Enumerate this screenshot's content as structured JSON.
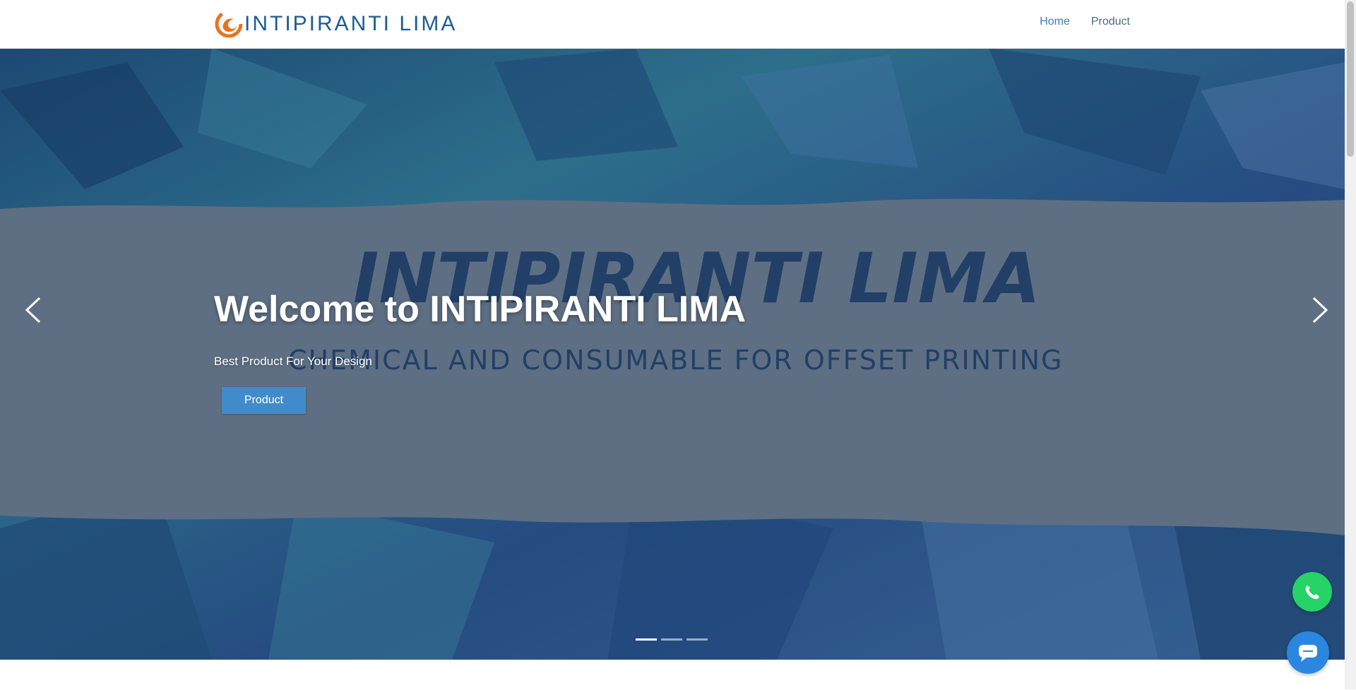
{
  "brand": {
    "name": "INTIPIRANTI LIMA",
    "logo_icon": "spiral-sun-logo-icon",
    "logo_color": "#e8731f",
    "name_color": "#1d5c93"
  },
  "nav": {
    "items": [
      {
        "label": "Home"
      },
      {
        "label": "Product"
      }
    ]
  },
  "hero": {
    "art_title": "INTIPIRANTI LIMA",
    "art_subtitle": "CHEMICAL AND CONSUMABLE FOR OFFSET PRINTING",
    "title": "Welcome to INTIPIRANTI LIMA",
    "subtitle": "Best Product For Your Design",
    "button_label": "Product",
    "button_color": "#428bca",
    "prev_icon": "chevron-left-icon",
    "next_icon": "chevron-right-icon",
    "slide_count": 3,
    "active_slide": 1
  },
  "floating": {
    "whatsapp_icon": "whatsapp-icon",
    "whatsapp_color": "#25d366",
    "chat_icon": "chat-bubble-icon",
    "chat_color": "#2b86e0"
  }
}
